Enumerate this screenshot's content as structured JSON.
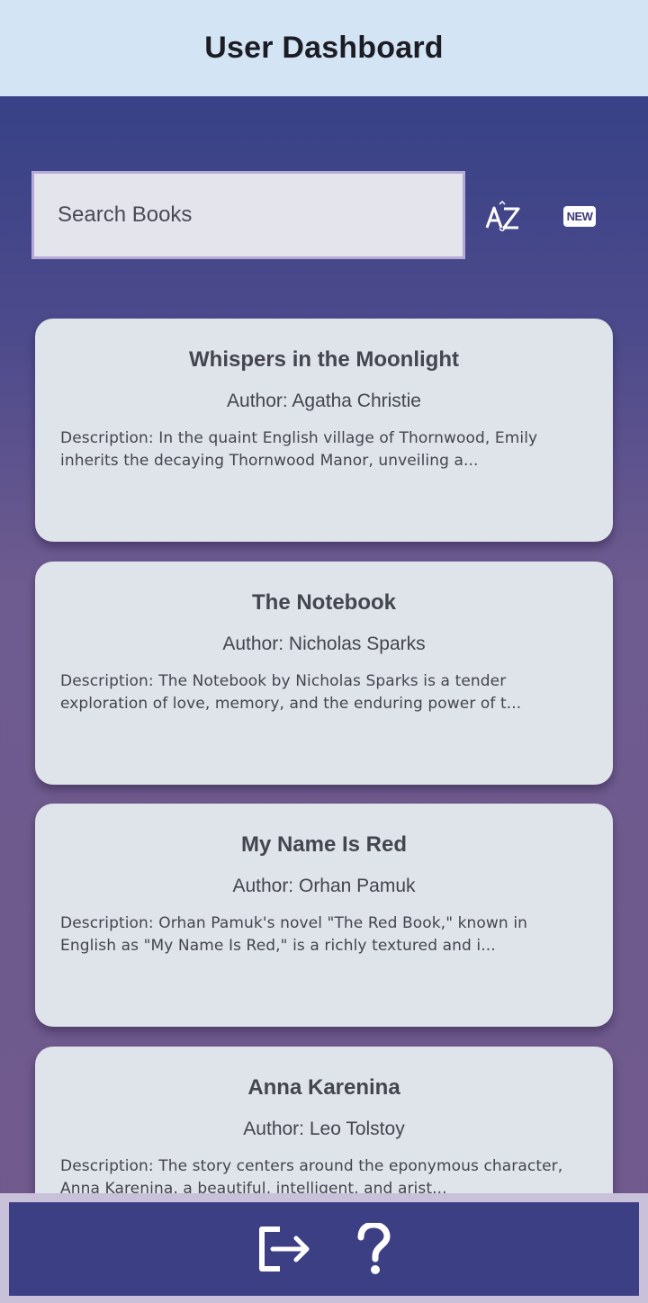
{
  "header": {
    "title": "User Dashboard"
  },
  "search": {
    "placeholder": "Search Books"
  },
  "toolbar": {
    "sort_alpha_icon": "sort-alphabetical-icon",
    "sort_new_label": "NEW"
  },
  "books": [
    {
      "title": "Whispers in the Moonlight",
      "author": "Author: Agatha Christie",
      "description": "Description: In the quaint English village of Thornwood, Emily inherits the decaying Thornwood Manor, unveiling a..."
    },
    {
      "title": "The Notebook",
      "author": "Author: Nicholas Sparks",
      "description": "Description: The Notebook by Nicholas Sparks is a tender exploration of love, memory, and the enduring power of t..."
    },
    {
      "title": "My Name Is Red",
      "author": "Author: Orhan Pamuk",
      "description": "Description: Orhan Pamuk's novel \"The Red Book,\" known in English as \"My Name Is Red,\" is a richly textured and i..."
    },
    {
      "title": "Anna Karenina",
      "author": "Author: Leo Tolstoy",
      "description": "Description: The story centers around the eponymous character, Anna Karenina, a beautiful, intelligent, and arist..."
    }
  ],
  "bottom_nav": {
    "logout_icon": "logout-icon",
    "help_label": "?"
  },
  "colors": {
    "header_bg": "#d3e4f4",
    "card_bg": "#dfe3ea",
    "nav_bg": "#3c3f84",
    "search_border": "#b6a9d6"
  }
}
